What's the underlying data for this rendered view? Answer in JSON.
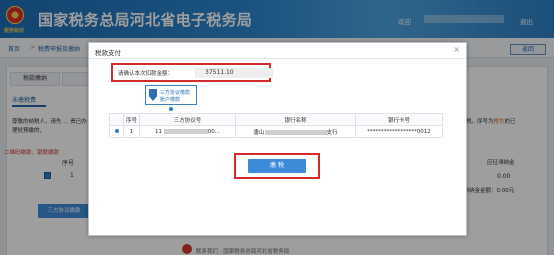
{
  "header": {
    "title": "国家税务总局河北省电子税务局",
    "logo_text": "税务标识",
    "welcome": "欢迎",
    "logout": "退出"
  },
  "nav": {
    "home": "首页",
    "separator": ">",
    "page": "税费申报及缴纳",
    "return": "返回"
  },
  "background": {
    "tab_tax": "税款缴纳",
    "tab_tax2": "",
    "subtab": "未缴税费",
    "notice_left": "尊敬的纳税人，请先 ... 责已办理批预缴的，",
    "warning_left": "二维码缴款、银联缴款",
    "col_seq": "序号",
    "row_num": "1",
    "col_pay": "应征滞纳金",
    "val_pay": "0.00",
    "notice_right_a": "税。序号为",
    "notice_right_hi": "橙色",
    "notice_right_b": "的已",
    "total": "中滞纳金金额：0.00元",
    "agreement_button": "三方协议缴款",
    "footer": "联系我们 · 国家税务总局河北省税务局"
  },
  "modal": {
    "title": "税款支付",
    "close": "×",
    "amount_label": "请确认本次扣款金额：",
    "amount_value": "37511.10",
    "badge_line1": "三方协议缴款",
    "badge_line2": "账户缴款",
    "table": {
      "headers": [
        "序号",
        "三方协议号",
        "银行名称",
        "银行卡号"
      ],
      "row": {
        "seq": "1",
        "agreement_no": "11",
        "agreement_suffix": "00...",
        "bank_prefix": "唐山",
        "bank_suffix": "支行",
        "card_prefix": "******************",
        "card_suffix": "0012"
      }
    },
    "pay_button": "缴 税"
  }
}
